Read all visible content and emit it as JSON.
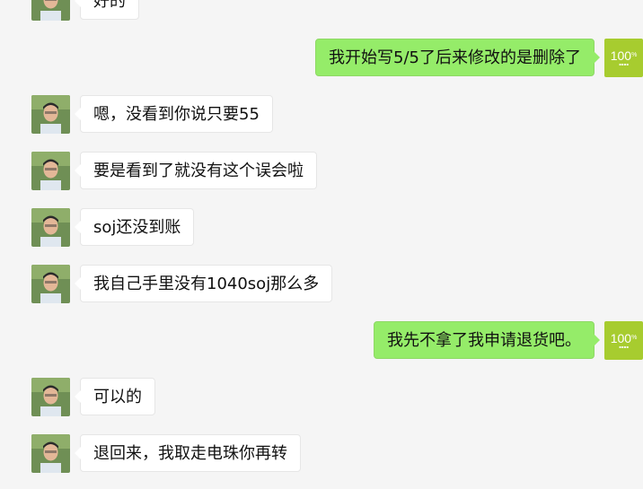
{
  "colors": {
    "background": "#f5f5f5",
    "self_bubble": "#95ec69",
    "other_bubble": "#ffffff",
    "self_avatar": "#a7cc2f"
  },
  "self_avatar": {
    "label": "100",
    "percent": "%"
  },
  "messages": [
    {
      "side": "left",
      "text": "好的"
    },
    {
      "side": "right",
      "text": "我开始写5/5了后来修改的是删除了"
    },
    {
      "side": "left",
      "text": "嗯，没看到你说只要55"
    },
    {
      "side": "left",
      "text": "要是看到了就没有这个误会啦"
    },
    {
      "side": "left",
      "text": "soj还没到账"
    },
    {
      "side": "left",
      "text": "我自己手里没有1040soj那么多"
    },
    {
      "side": "right",
      "text": "我先不拿了我申请退货吧。"
    },
    {
      "side": "left",
      "text": "可以的"
    },
    {
      "side": "left",
      "text": "退回来，我取走电珠你再转"
    }
  ]
}
